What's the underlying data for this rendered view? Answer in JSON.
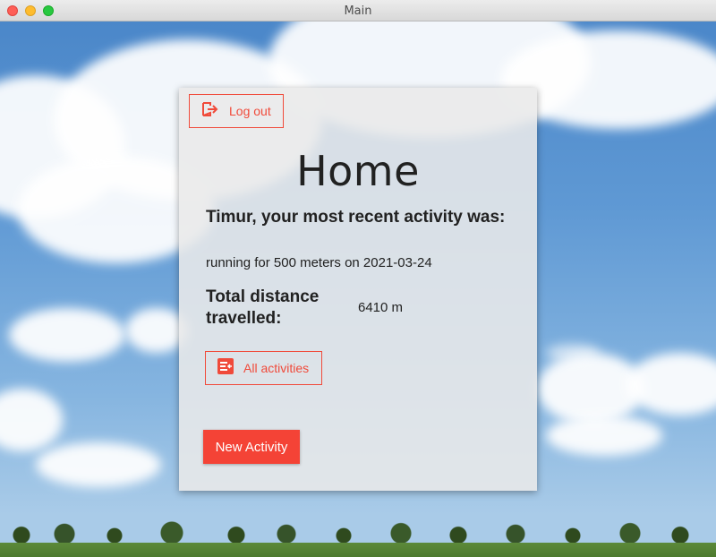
{
  "window": {
    "title": "Main"
  },
  "header": {
    "logout_label": "Log out",
    "logout_icon": "logout-icon"
  },
  "main": {
    "title": "Home",
    "recent_heading": "Timur, your most recent activity was:",
    "recent_activity": "running for 500 meters on 2021-03-24",
    "distance_label": "Total distance travelled:",
    "distance_value": "6410 m",
    "all_activities_label": "All activities",
    "all_activities_icon": "list-icon",
    "new_activity_label": "New Activity"
  },
  "colors": {
    "accent": "#f44336",
    "accent_outline": "#f04a3a",
    "text": "#212121"
  }
}
